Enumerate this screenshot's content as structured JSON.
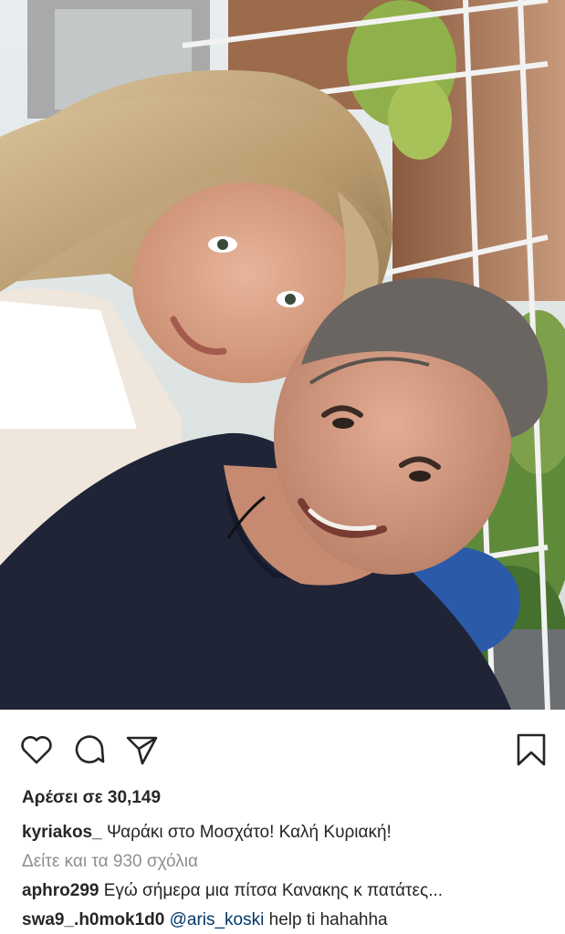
{
  "post": {
    "likes_text": "Αρέσει σε 30,149",
    "caption": {
      "username": "kyriakos_",
      "text": " Ψαράκι στο Μοσχάτο! Καλή Κυριακή!"
    },
    "view_comments": "Δείτε και τα 930 σχόλια",
    "comments": [
      {
        "username": "aphro299",
        "text": " Εγώ σήμερα μια πίτσα Κανακης κ πατάτες..."
      },
      {
        "username": "swa9_.h0mok1d0",
        "mention": " @aris_koski",
        "text": " help ti hahahha"
      }
    ]
  },
  "actions": {
    "like_icon": "heart-icon",
    "comment_icon": "comment-bubble-icon",
    "share_icon": "paper-plane-icon",
    "save_icon": "bookmark-icon"
  },
  "colors": {
    "text": "#262626",
    "muted": "#8e8e8e",
    "mention": "#00376b"
  }
}
